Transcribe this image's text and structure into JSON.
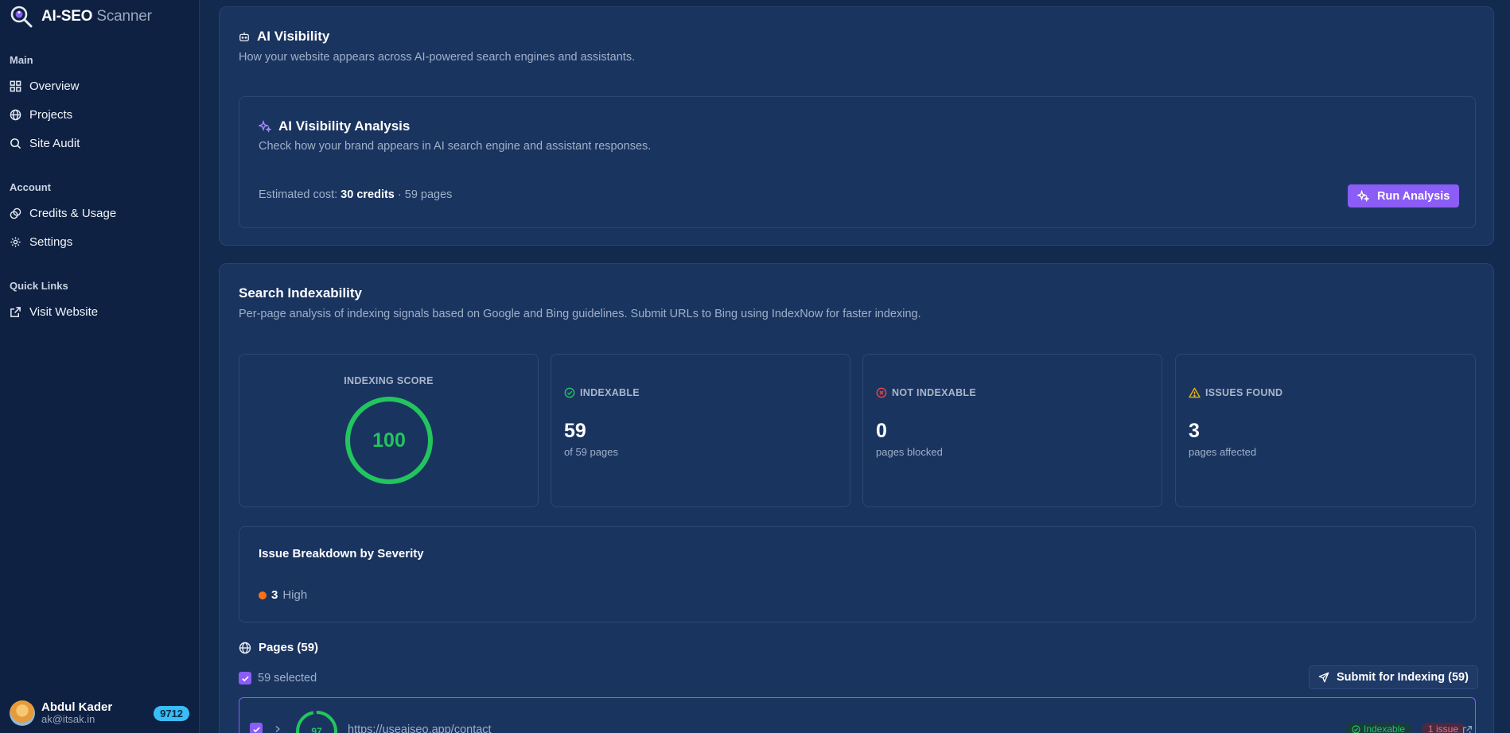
{
  "brand": {
    "name_bold": "AI-SEO",
    "name_light": "Scanner"
  },
  "sidebar": {
    "main_heading": "Main",
    "main_items": [
      {
        "label": "Overview",
        "icon": "grid-icon"
      },
      {
        "label": "Projects",
        "icon": "globe-icon"
      },
      {
        "label": "Site Audit",
        "icon": "search-icon"
      }
    ],
    "account_heading": "Account",
    "account_items": [
      {
        "label": "Credits & Usage",
        "icon": "coins-icon"
      },
      {
        "label": "Settings",
        "icon": "gear-icon"
      }
    ],
    "links_heading": "Quick Links",
    "links_items": [
      {
        "label": "Visit Website",
        "icon": "external-link-icon"
      }
    ]
  },
  "user": {
    "name": "Abdul Kader",
    "email": "ak@itsak.in",
    "credits": "9712"
  },
  "ai_visibility": {
    "title": "AI Visibility",
    "description": "How your website appears across AI-powered search engines and assistants.",
    "analysis": {
      "title": "AI Visibility Analysis",
      "description": "Check how your brand appears in AI search engine and assistant responses.",
      "cost_prefix": "Estimated cost: ",
      "cost_value": "30 credits",
      "cost_suffix": " · 59 pages",
      "run_label": "Run Analysis"
    }
  },
  "indexability": {
    "title": "Search Indexability",
    "description": "Per-page analysis of indexing signals based on Google and Bing guidelines. Submit URLs to Bing using IndexNow for faster indexing.",
    "score_label": "INDEXING SCORE",
    "score_value": "100",
    "score_fraction": 1.0,
    "stats": [
      {
        "label": "INDEXABLE",
        "value": "59",
        "sub": "of 59 pages",
        "icon": "check-circle-icon",
        "color": "#22c55e"
      },
      {
        "label": "NOT INDEXABLE",
        "value": "0",
        "sub": "pages blocked",
        "icon": "x-circle-icon",
        "color": "#ef4444"
      },
      {
        "label": "ISSUES FOUND",
        "value": "3",
        "sub": "pages affected",
        "icon": "warning-icon",
        "color": "#eab308"
      }
    ],
    "breakdown": {
      "title": "Issue Breakdown by Severity",
      "count": "3",
      "severity": "High",
      "color": "#f97316"
    },
    "pages": {
      "title": "Pages (59)",
      "selected_label": "59 selected",
      "submit_label": "Submit for Indexing (59)",
      "first_row": {
        "score": "97",
        "score_fraction": 0.97,
        "url": "https://useaiseo.app/contact",
        "status": "Indexable",
        "issues": "1 issue"
      }
    }
  },
  "colors": {
    "accent": "#8b5cf6",
    "success": "#22c55e",
    "badge": "#38bdf8"
  }
}
